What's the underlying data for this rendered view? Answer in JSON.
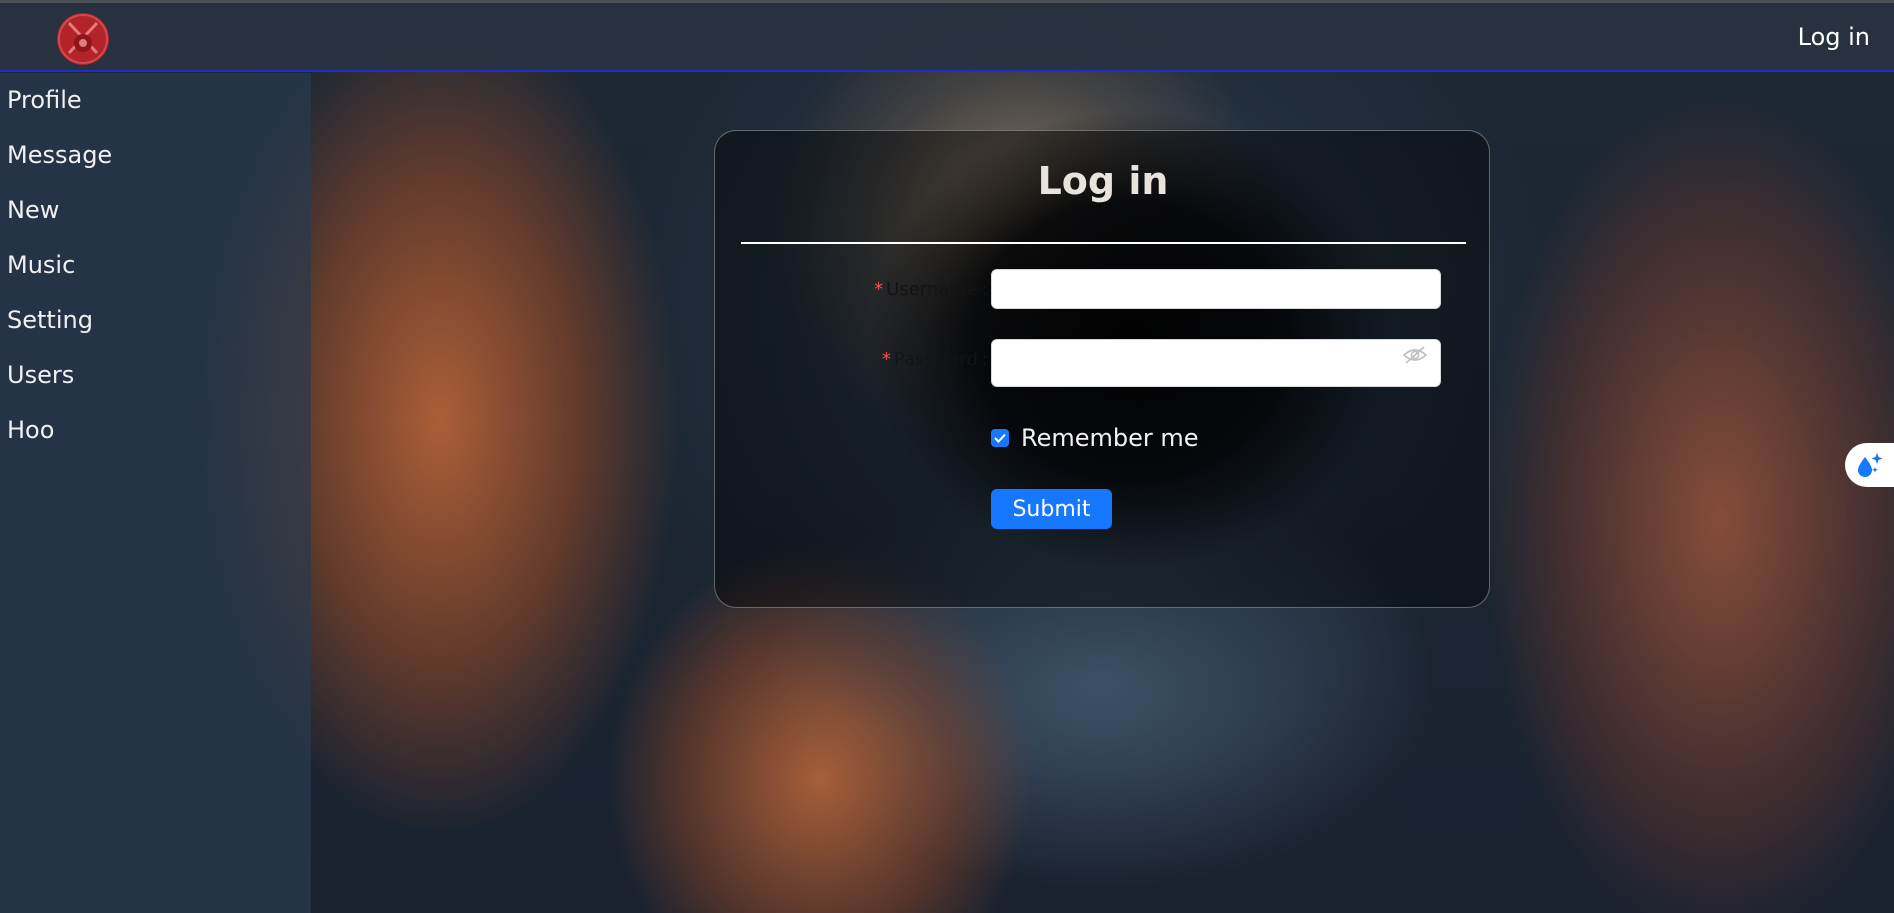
{
  "header": {
    "logo_icon": "logo-icon",
    "login_link": "Log in",
    "accent_border": "#1f2cc8"
  },
  "sidebar": {
    "items": [
      {
        "label": "Profile"
      },
      {
        "label": "Message"
      },
      {
        "label": "New"
      },
      {
        "label": "Music"
      },
      {
        "label": "Setting"
      },
      {
        "label": "Users"
      },
      {
        "label": "Hoo"
      }
    ]
  },
  "login_form": {
    "title": "Log in",
    "username": {
      "label": "Username",
      "required_mark": "*",
      "value": ""
    },
    "password": {
      "label": "Password",
      "required_mark": "*",
      "value": "",
      "toggle_icon": "eye-off-icon"
    },
    "remember_me": {
      "label": "Remember me",
      "checked": true
    },
    "submit_label": "Submit",
    "accent_color": "#1677ff"
  },
  "floating_button": {
    "icon": "sparkle-drop-icon"
  }
}
